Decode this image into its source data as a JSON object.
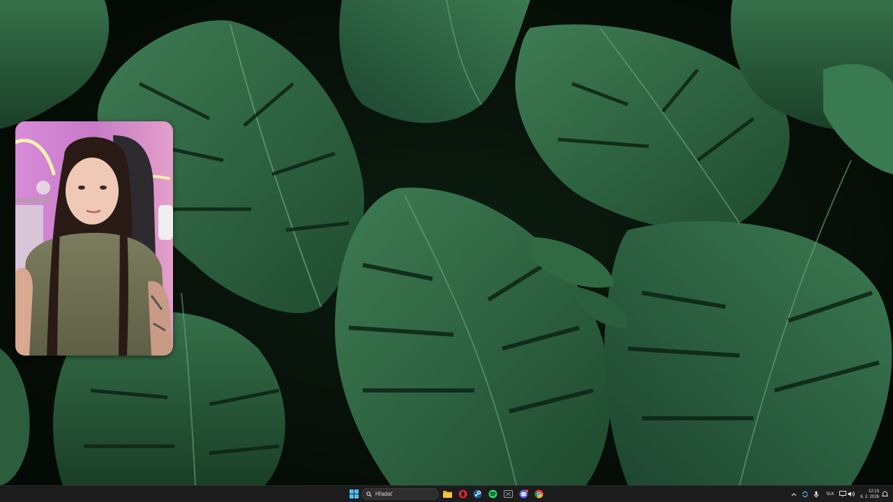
{
  "taskbar": {
    "search_label": "Hľadať",
    "pinned_apps": [
      {
        "name": "file-explorer",
        "color": "#f6c43b"
      },
      {
        "name": "opera",
        "color": "#e1262f"
      },
      {
        "name": "steam",
        "color": "#1b90d6"
      },
      {
        "name": "spotify",
        "color": "#1ed760"
      },
      {
        "name": "xbox",
        "color": "#9aa0a6"
      },
      {
        "name": "discord",
        "color": "#5865f2"
      },
      {
        "name": "chrome",
        "color": "#e34133"
      }
    ],
    "tray": {
      "language": "SLK",
      "time": "12:13",
      "date": "6. 2. 2026"
    }
  },
  "colors": {
    "taskbar_bg": "#1c1c1c",
    "leaf_dark": "#1f4a2e",
    "leaf_mid": "#2f6a43",
    "leaf_light": "#3f7e54",
    "background": "#071208"
  }
}
